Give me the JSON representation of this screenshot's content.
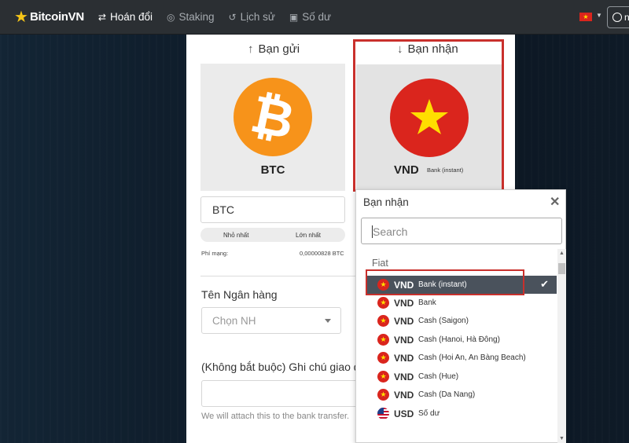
{
  "navbar": {
    "brand": "BitcoinVN",
    "items": [
      {
        "label": "Hoán đổi",
        "icon": "exchange-icon",
        "active": true
      },
      {
        "label": "Staking",
        "icon": "coins-icon",
        "active": false
      },
      {
        "label": "Lịch sử",
        "icon": "history-icon",
        "active": false
      },
      {
        "label": "Số dư",
        "icon": "wallet-icon",
        "active": false
      }
    ],
    "user_initial": "n"
  },
  "send": {
    "header": "Bạn gửi",
    "currency": "BTC",
    "amount": "BTC",
    "min_label": "Nhỏ nhất",
    "max_label": "Lớn nhất",
    "fee_label": "Phí mạng:",
    "fee_value": "0,00000828 BTC"
  },
  "receive": {
    "header": "Bạn nhận",
    "currency": "VND",
    "method": "Bank (instant)"
  },
  "form": {
    "bank_label": "Tên Ngân hàng",
    "bank_placeholder": "Chọn NH",
    "note_label": "(Không bắt buộc) Ghi chú giao dịch",
    "note_hint": "We will attach this to the bank transfer."
  },
  "dropdown": {
    "title": "Bạn nhận",
    "search_placeholder": "Search",
    "group": "Fiat",
    "items": [
      {
        "code": "VND",
        "method": "Bank (instant)",
        "flag": "vn",
        "selected": true
      },
      {
        "code": "VND",
        "method": "Bank",
        "flag": "vn",
        "selected": false
      },
      {
        "code": "VND",
        "method": "Cash (Saigon)",
        "flag": "vn",
        "selected": false
      },
      {
        "code": "VND",
        "method": "Cash (Hanoi, Hà Đông)",
        "flag": "vn",
        "selected": false
      },
      {
        "code": "VND",
        "method": "Cash (Hoi An, An Bàng Beach)",
        "flag": "vn",
        "selected": false
      },
      {
        "code": "VND",
        "method": "Cash (Hue)",
        "flag": "vn",
        "selected": false
      },
      {
        "code": "VND",
        "method": "Cash (Da Nang)",
        "flag": "vn",
        "selected": false
      },
      {
        "code": "USD",
        "method": "Số dư",
        "flag": "us",
        "selected": false
      }
    ]
  },
  "colors": {
    "navbar": "#2b2f33",
    "btc": "#f7931a",
    "vn_red": "#da251d",
    "vn_star": "#ffde00",
    "highlight": "#c9302c",
    "selected_row": "#4a525c"
  }
}
